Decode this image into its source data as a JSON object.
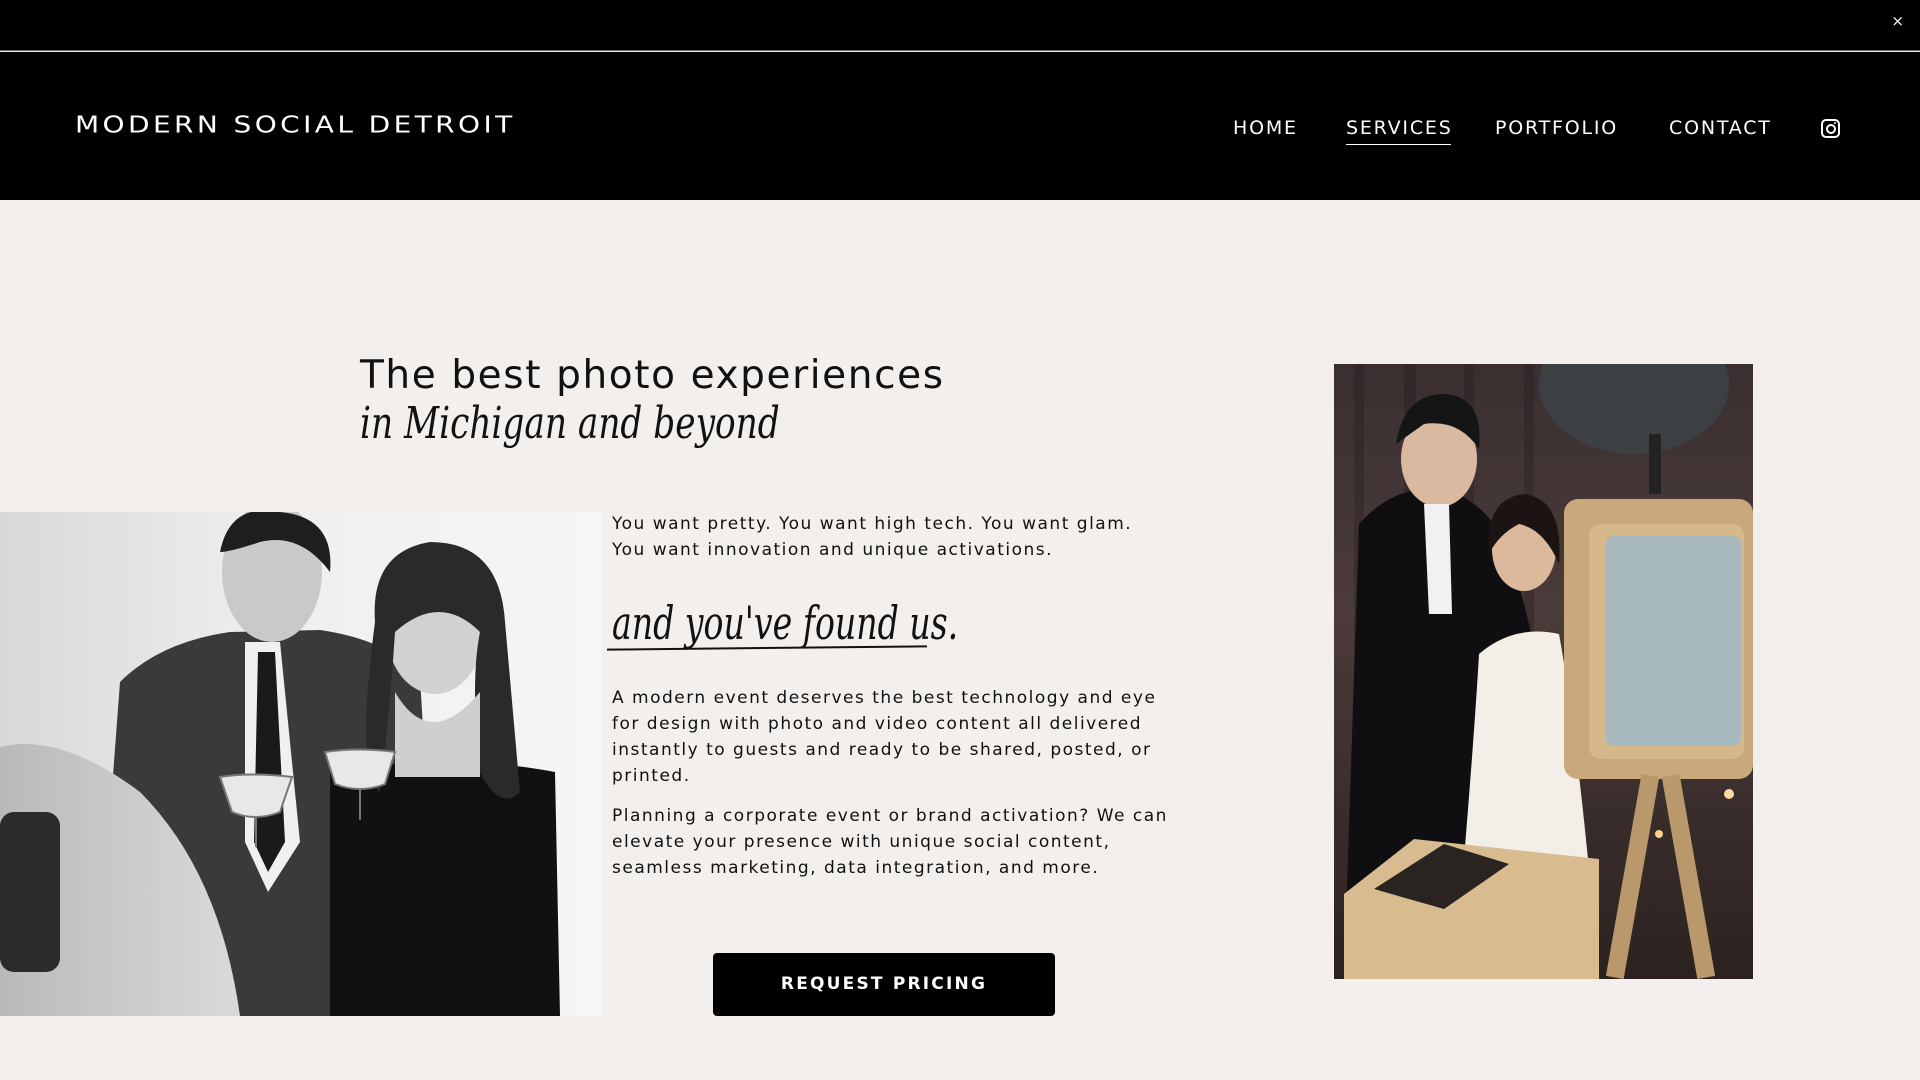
{
  "announcement_bar": {
    "close_label": "×"
  },
  "header": {
    "logo": "MODERN SOCIAL DETROIT",
    "nav": [
      {
        "label": "HOME",
        "active": false
      },
      {
        "label": "SERVICES",
        "active": true
      },
      {
        "label": "PORTFOLIO",
        "active": false
      },
      {
        "label": "CONTACT",
        "active": false
      }
    ],
    "social_icon": "instagram-icon"
  },
  "hero": {
    "heading": "The best photo experiences",
    "heading_script": "in Michigan and beyond",
    "intro": "You want pretty. You want high tech. You want glam. You want innovation and unique activations.",
    "script_tagline": "and you've found us.",
    "paragraph_1": "A modern event deserves the best technology and eye for design with photo and video content all delivered instantly to guests and ready to be shared, posted, or printed.",
    "paragraph_2": "Planning a corporate event or brand activation? We can elevate your presence with unique social content, seamless marketing, data integration, and more.",
    "cta_label": "REQUEST PRICING"
  },
  "colors": {
    "page_background": "#f2efec",
    "header_background": "#000000",
    "text": "#111111",
    "button_background": "#000000"
  }
}
